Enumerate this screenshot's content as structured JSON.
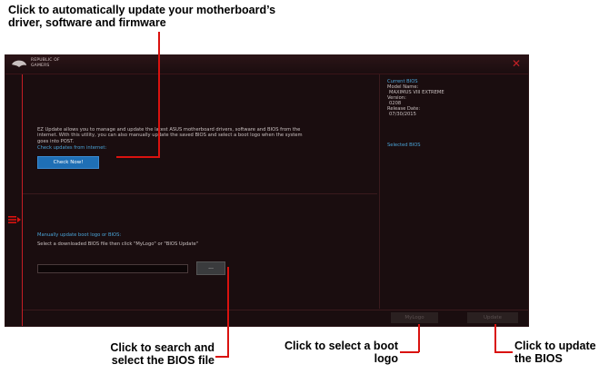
{
  "callouts": {
    "top": "Click to automatically update your motherboard’s driver, software and firmware",
    "browse": "Click to search and select the BIOS file",
    "logo": "Click to select a boot logo",
    "update": "Click to update the BIOS"
  },
  "app": {
    "brand_line1": "REPUBLIC OF",
    "brand_line2": "GAMERS"
  },
  "main": {
    "description": "EZ Update allows you to manage and update the latest ASUS motherboard drivers, software and BIOS from the internet. With this utility, you can also manually update the saved BIOS and select a boot logo when the system goes into POST.",
    "check_heading": "Check updates from internet:",
    "check_button": "Check Now!",
    "manual_heading": "Manually update boot logo or BIOS:",
    "manual_instruction": "Select a downloaded BIOS file then click \"MyLogo\" or \"BIOS Update\"",
    "browse_button": "..."
  },
  "bios": {
    "current_heading": "Current BIOS",
    "model_label": "Model Name:",
    "model_value": "MAXIMUS VIII EXTREME",
    "version_label": "Version:",
    "version_value": "0208",
    "release_label": "Release Date:",
    "release_value": "07/30/2015",
    "selected_heading": "Selected BIOS"
  },
  "bottom": {
    "mylogo_button": "MyLogo",
    "update_button": "Update"
  },
  "colors": {
    "accent": "#d9120f",
    "window_bg": "#1a0d0f",
    "link_blue": "#4aa4d8",
    "button_blue": "#1f6fb5"
  }
}
